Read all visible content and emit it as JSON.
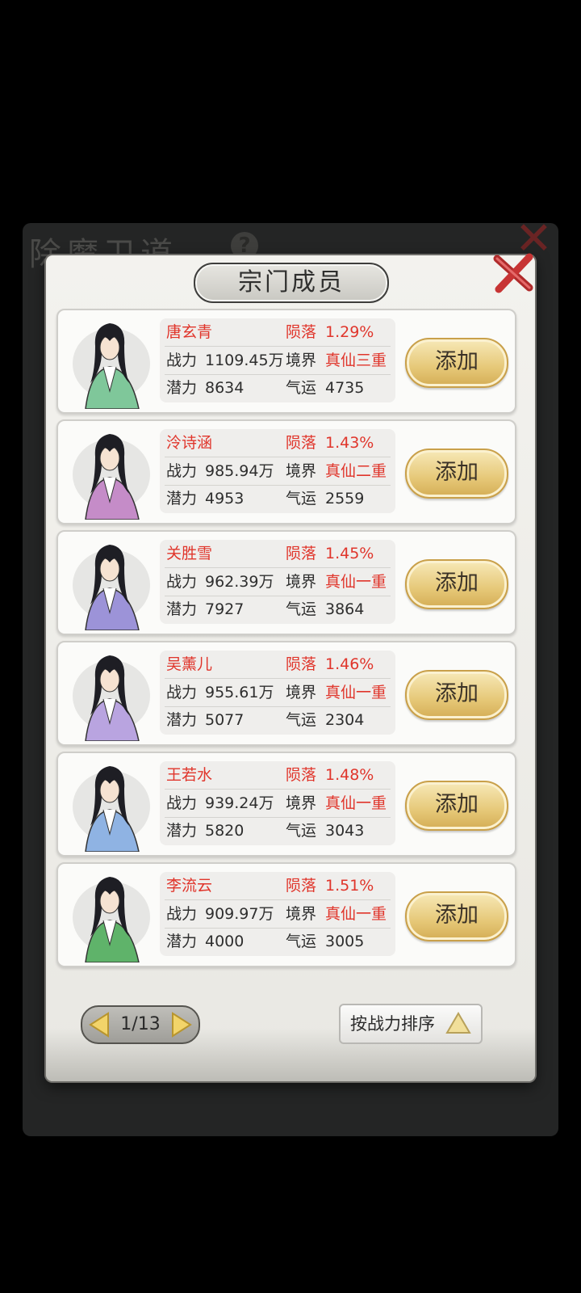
{
  "background": {
    "title": "除魔卫道",
    "help_icon": "?"
  },
  "dialog": {
    "title": "宗门成员",
    "close_icon": "close-x-icon"
  },
  "labels": {
    "power": "战力",
    "realm": "境界",
    "potential": "潜力",
    "luck": "气运",
    "fall": "陨落"
  },
  "members": [
    {
      "name": "唐玄青",
      "fall_rate": "1.29%",
      "power": "1109.45万",
      "realm": "真仙三重",
      "potential": "8634",
      "luck": "4735",
      "action": "添加",
      "robe_color": "#7fc79a"
    },
    {
      "name": "泠诗涵",
      "fall_rate": "1.43%",
      "power": "985.94万",
      "realm": "真仙二重",
      "potential": "4953",
      "luck": "2559",
      "action": "添加",
      "robe_color": "#c58cc8"
    },
    {
      "name": "关胜雪",
      "fall_rate": "1.45%",
      "power": "962.39万",
      "realm": "真仙一重",
      "potential": "7927",
      "luck": "3864",
      "action": "添加",
      "robe_color": "#9c93d8"
    },
    {
      "name": "吴薰儿",
      "fall_rate": "1.46%",
      "power": "955.61万",
      "realm": "真仙一重",
      "potential": "5077",
      "luck": "2304",
      "action": "添加",
      "robe_color": "#b9a4e0"
    },
    {
      "name": "王若水",
      "fall_rate": "1.48%",
      "power": "939.24万",
      "realm": "真仙一重",
      "potential": "5820",
      "luck": "3043",
      "action": "添加",
      "robe_color": "#8fb3e3"
    },
    {
      "name": "李流云",
      "fall_rate": "1.51%",
      "power": "909.97万",
      "realm": "真仙一重",
      "potential": "4000",
      "luck": "3005",
      "action": "添加",
      "robe_color": "#5fb36a"
    }
  ],
  "pagination": {
    "text": "1/13",
    "prev_icon": "triangle-left-icon",
    "next_icon": "triangle-right-icon"
  },
  "sort": {
    "label": "按战力排序",
    "icon": "triangle-up-icon"
  },
  "colors": {
    "accent_red": "#e0352b",
    "button_gold": "#e6c878"
  }
}
